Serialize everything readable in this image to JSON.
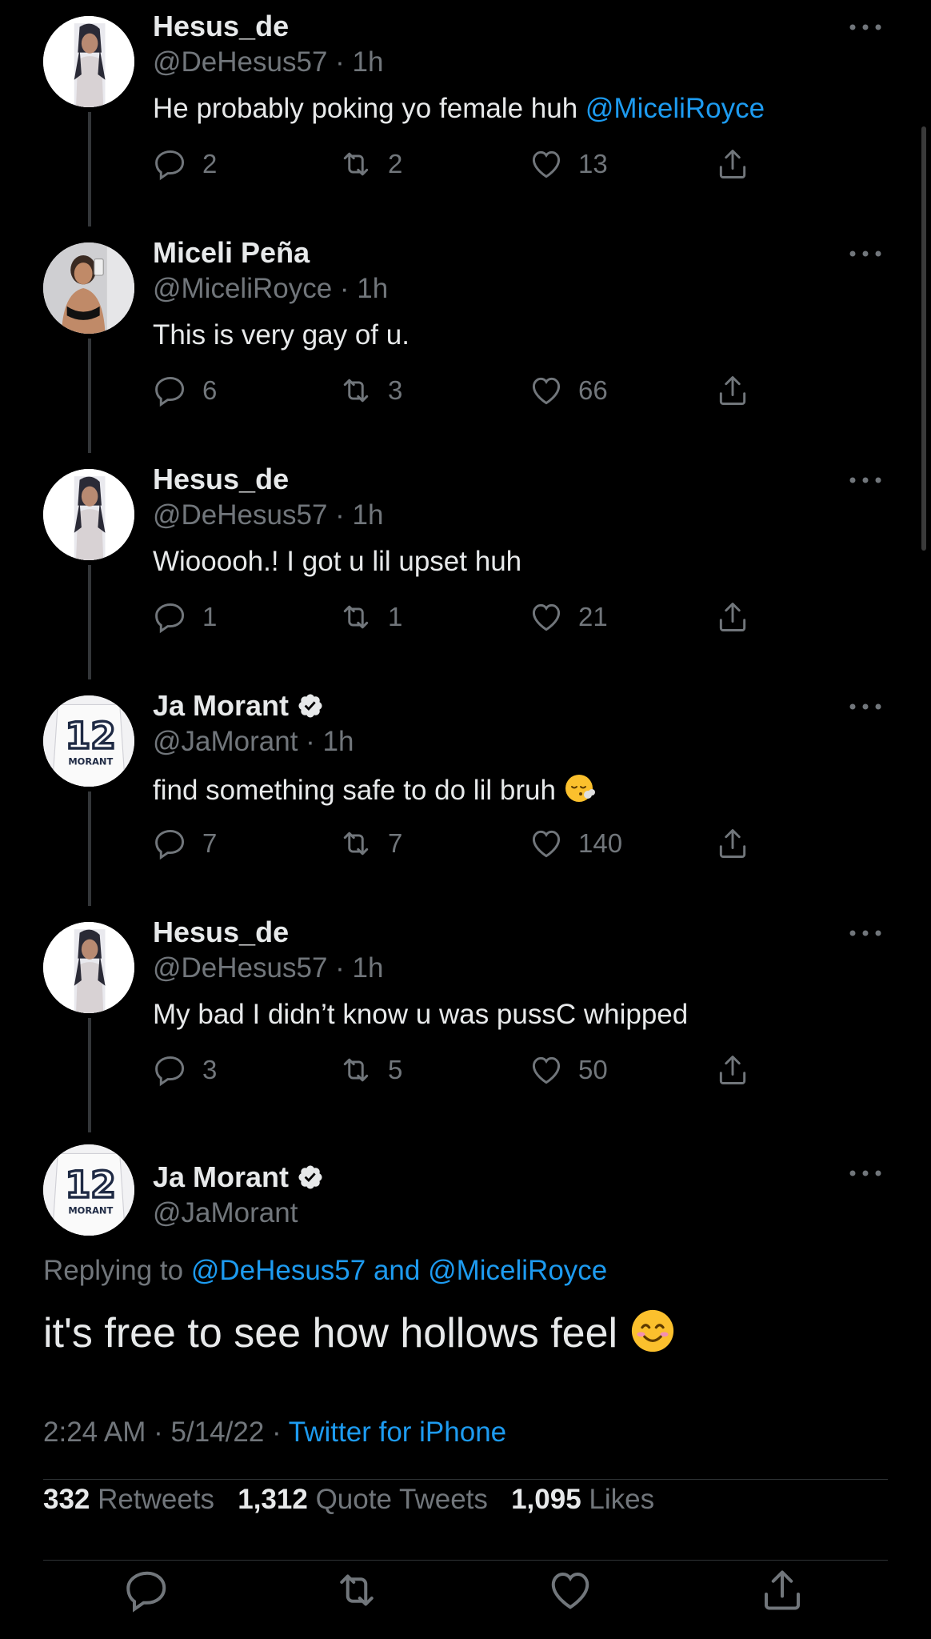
{
  "colors": {
    "background": "#000000",
    "text": "#e7e9ea",
    "muted": "#71767b",
    "link": "#1d9bf0",
    "verified": "#e7e9ea"
  },
  "replies": [
    {
      "name": "Hesus_de",
      "handle": "@DeHesus57",
      "time": "1h",
      "verified": false,
      "text": "He probably poking yo female huh ",
      "mention": "@MiceliRoyce",
      "emoji": "",
      "replies": "2",
      "retweets": "2",
      "likes": "13",
      "avatar": "hesus"
    },
    {
      "name": "Miceli Peña",
      "handle": "@MiceliRoyce",
      "time": "1h",
      "verified": false,
      "text": "This is very gay of u.",
      "mention": "",
      "emoji": "",
      "replies": "6",
      "retweets": "3",
      "likes": "66",
      "avatar": "miceli"
    },
    {
      "name": "Hesus_de",
      "handle": "@DeHesus57",
      "time": "1h",
      "verified": false,
      "text": "Wiooooh.! I got u lil upset huh",
      "mention": "",
      "emoji": "",
      "replies": "1",
      "retweets": "1",
      "likes": "21",
      "avatar": "hesus"
    },
    {
      "name": "Ja Morant",
      "handle": "@JaMorant",
      "time": "1h",
      "verified": true,
      "text": "find something safe to do lil bruh ",
      "mention": "",
      "emoji": "😮‍💨",
      "replies": "7",
      "retweets": "7",
      "likes": "140",
      "avatar": "ja"
    },
    {
      "name": "Hesus_de",
      "handle": "@DeHesus57",
      "time": "1h",
      "verified": false,
      "text": "My bad I didn’t know u was pussC whipped",
      "mention": "",
      "emoji": "",
      "replies": "3",
      "retweets": "5",
      "likes": "50",
      "avatar": "hesus"
    }
  ],
  "main_tweet": {
    "name": "Ja Morant",
    "handle": "@JaMorant",
    "replying_prefix": "Replying to ",
    "replying_to": "@DeHesus57 and @MiceliRoyce",
    "text": "it's free to see how hollows feel ",
    "emoji": "😊",
    "time": "2:24 AM",
    "date": "5/14/22",
    "source": "Twitter for iPhone",
    "retweets_count": "332",
    "retweets_label": "Retweets",
    "quotes_count": "1,312",
    "quotes_label": "Quote Tweets",
    "likes_count": "1,095",
    "likes_label": "Likes"
  },
  "jersey": {
    "number": "12",
    "name": "MORANT"
  },
  "icons": {
    "reply": "reply-icon",
    "retweet": "retweet-icon",
    "like": "heart-icon",
    "share": "share-icon",
    "more": "more-icon",
    "verified": "verified-badge-icon"
  }
}
